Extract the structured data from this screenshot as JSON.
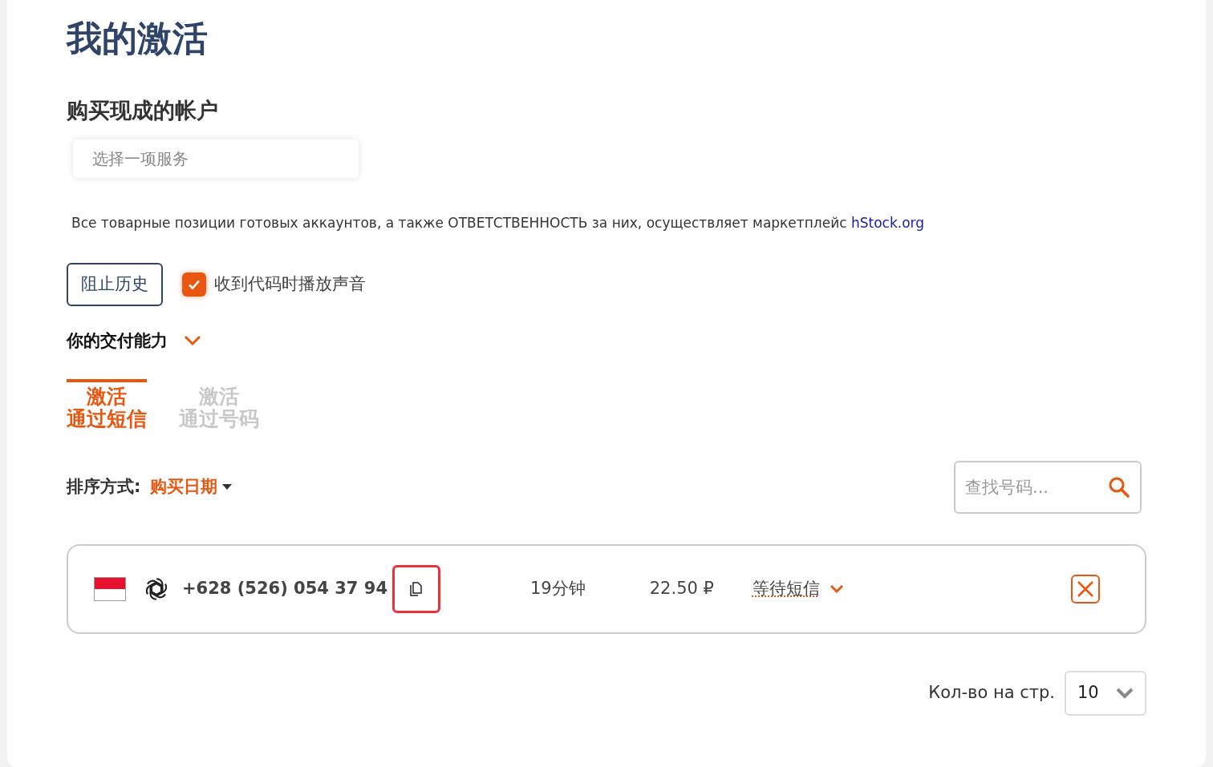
{
  "title": "我的激活",
  "section_title": "购买现成的帐户",
  "service_select": {
    "placeholder": "选择一项服务"
  },
  "notice": {
    "text": "Все товарные позиции готовых аккаунтов, а также ОТВЕТСТВЕННОСТЬ за них, осуществляет маркетплейс",
    "link": "hStock.org"
  },
  "history_button": "阻止历史",
  "sound_checkbox": {
    "label": "收到代码时播放声音",
    "checked": true
  },
  "delivery_toggle": "你的交付能力",
  "tabs": [
    {
      "line1": "激活",
      "line2": "通过短信",
      "selected": true
    },
    {
      "line1": "激活",
      "line2": "通过号码",
      "selected": false
    }
  ],
  "sort": {
    "label": "排序方式:",
    "value": "购买日期"
  },
  "search": {
    "placeholder": "查找号码..."
  },
  "rows": [
    {
      "phone": "+628 (526) 054 37 94",
      "time": "19分钟",
      "price": "22.50 ₽",
      "status": "等待短信"
    }
  ],
  "per_page": {
    "label": "Кол-во на стр.",
    "value": "10"
  }
}
